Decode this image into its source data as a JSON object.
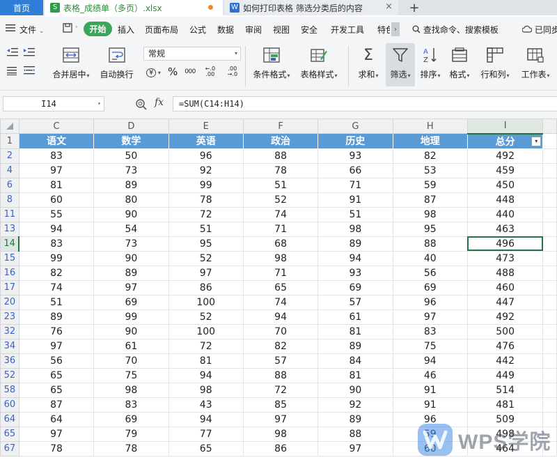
{
  "tabs": {
    "home": "首页",
    "file": "表格_成绩单（多页）.xlsx",
    "doc": "如何打印表格 筛选分类后的内容",
    "close": "×",
    "add": "+"
  },
  "menu": {
    "file": "文件",
    "start": "开始",
    "items": [
      "插入",
      "页面布局",
      "公式",
      "数据",
      "审阅",
      "视图",
      "安全",
      "开发工具",
      "特色"
    ],
    "more": "›",
    "search": "查找命令、搜索模板",
    "sync": "已同步"
  },
  "ribbon": {
    "merge": "合并居中",
    "wrap": "自动换行",
    "format": "常规",
    "currency": "¥",
    "percent": "%",
    "thousands": "000",
    "inc_decimal": "←.0 .00",
    "dec_decimal": ".00 →.0",
    "cond_format": "条件格式",
    "table_style": "表格样式",
    "sum": "求和",
    "filter": "筛选",
    "sort": "排序",
    "cell_format": "格式",
    "row_col": "行和列",
    "sheet": "工作表"
  },
  "formula_bar": {
    "cell_ref": "I14",
    "fx": "fx",
    "formula": "=SUM(C14:H14)"
  },
  "sheet": {
    "columns": [
      "C",
      "D",
      "E",
      "F",
      "G",
      "H",
      "I"
    ],
    "selected_column": "I",
    "header_row_num": "1",
    "headers": [
      "语文",
      "数学",
      "英语",
      "政治",
      "历史",
      "地理",
      "总分"
    ],
    "active_row": "14",
    "rows": [
      {
        "n": "2",
        "v": [
          "83",
          "50",
          "96",
          "88",
          "93",
          "82",
          "492"
        ]
      },
      {
        "n": "4",
        "v": [
          "97",
          "73",
          "92",
          "78",
          "66",
          "53",
          "459"
        ]
      },
      {
        "n": "6",
        "v": [
          "81",
          "89",
          "99",
          "51",
          "71",
          "59",
          "450"
        ]
      },
      {
        "n": "8",
        "v": [
          "60",
          "80",
          "78",
          "52",
          "91",
          "87",
          "448"
        ]
      },
      {
        "n": "11",
        "v": [
          "55",
          "90",
          "72",
          "74",
          "51",
          "98",
          "440"
        ]
      },
      {
        "n": "13",
        "v": [
          "94",
          "54",
          "51",
          "71",
          "98",
          "95",
          "463"
        ]
      },
      {
        "n": "14",
        "v": [
          "83",
          "73",
          "95",
          "68",
          "89",
          "88",
          "496"
        ]
      },
      {
        "n": "15",
        "v": [
          "99",
          "90",
          "52",
          "98",
          "94",
          "40",
          "473"
        ]
      },
      {
        "n": "16",
        "v": [
          "82",
          "89",
          "97",
          "71",
          "93",
          "56",
          "488"
        ]
      },
      {
        "n": "17",
        "v": [
          "74",
          "97",
          "86",
          "65",
          "69",
          "69",
          "460"
        ]
      },
      {
        "n": "20",
        "v": [
          "51",
          "69",
          "100",
          "74",
          "57",
          "96",
          "447"
        ]
      },
      {
        "n": "23",
        "v": [
          "89",
          "99",
          "52",
          "94",
          "61",
          "97",
          "492"
        ]
      },
      {
        "n": "32",
        "v": [
          "76",
          "90",
          "100",
          "70",
          "81",
          "83",
          "500"
        ]
      },
      {
        "n": "34",
        "v": [
          "97",
          "61",
          "72",
          "82",
          "89",
          "75",
          "476"
        ]
      },
      {
        "n": "36",
        "v": [
          "56",
          "70",
          "81",
          "57",
          "84",
          "94",
          "442"
        ]
      },
      {
        "n": "52",
        "v": [
          "65",
          "75",
          "94",
          "88",
          "81",
          "46",
          "449"
        ]
      },
      {
        "n": "58",
        "v": [
          "65",
          "98",
          "98",
          "72",
          "90",
          "91",
          "514"
        ]
      },
      {
        "n": "60",
        "v": [
          "87",
          "83",
          "43",
          "85",
          "92",
          "91",
          "481"
        ]
      },
      {
        "n": "64",
        "v": [
          "64",
          "69",
          "94",
          "97",
          "89",
          "96",
          "509"
        ]
      },
      {
        "n": "65",
        "v": [
          "97",
          "79",
          "77",
          "98",
          "88",
          "59",
          "498"
        ]
      },
      {
        "n": "67",
        "v": [
          "78",
          "78",
          "65",
          "86",
          "97",
          "60",
          "464"
        ]
      }
    ]
  },
  "watermark": "WPS学院",
  "colors": {
    "header_fill": "#5b9bd5",
    "start_pill": "#3aa65a",
    "home_tab": "#2f7fd8",
    "selection": "#217346"
  }
}
